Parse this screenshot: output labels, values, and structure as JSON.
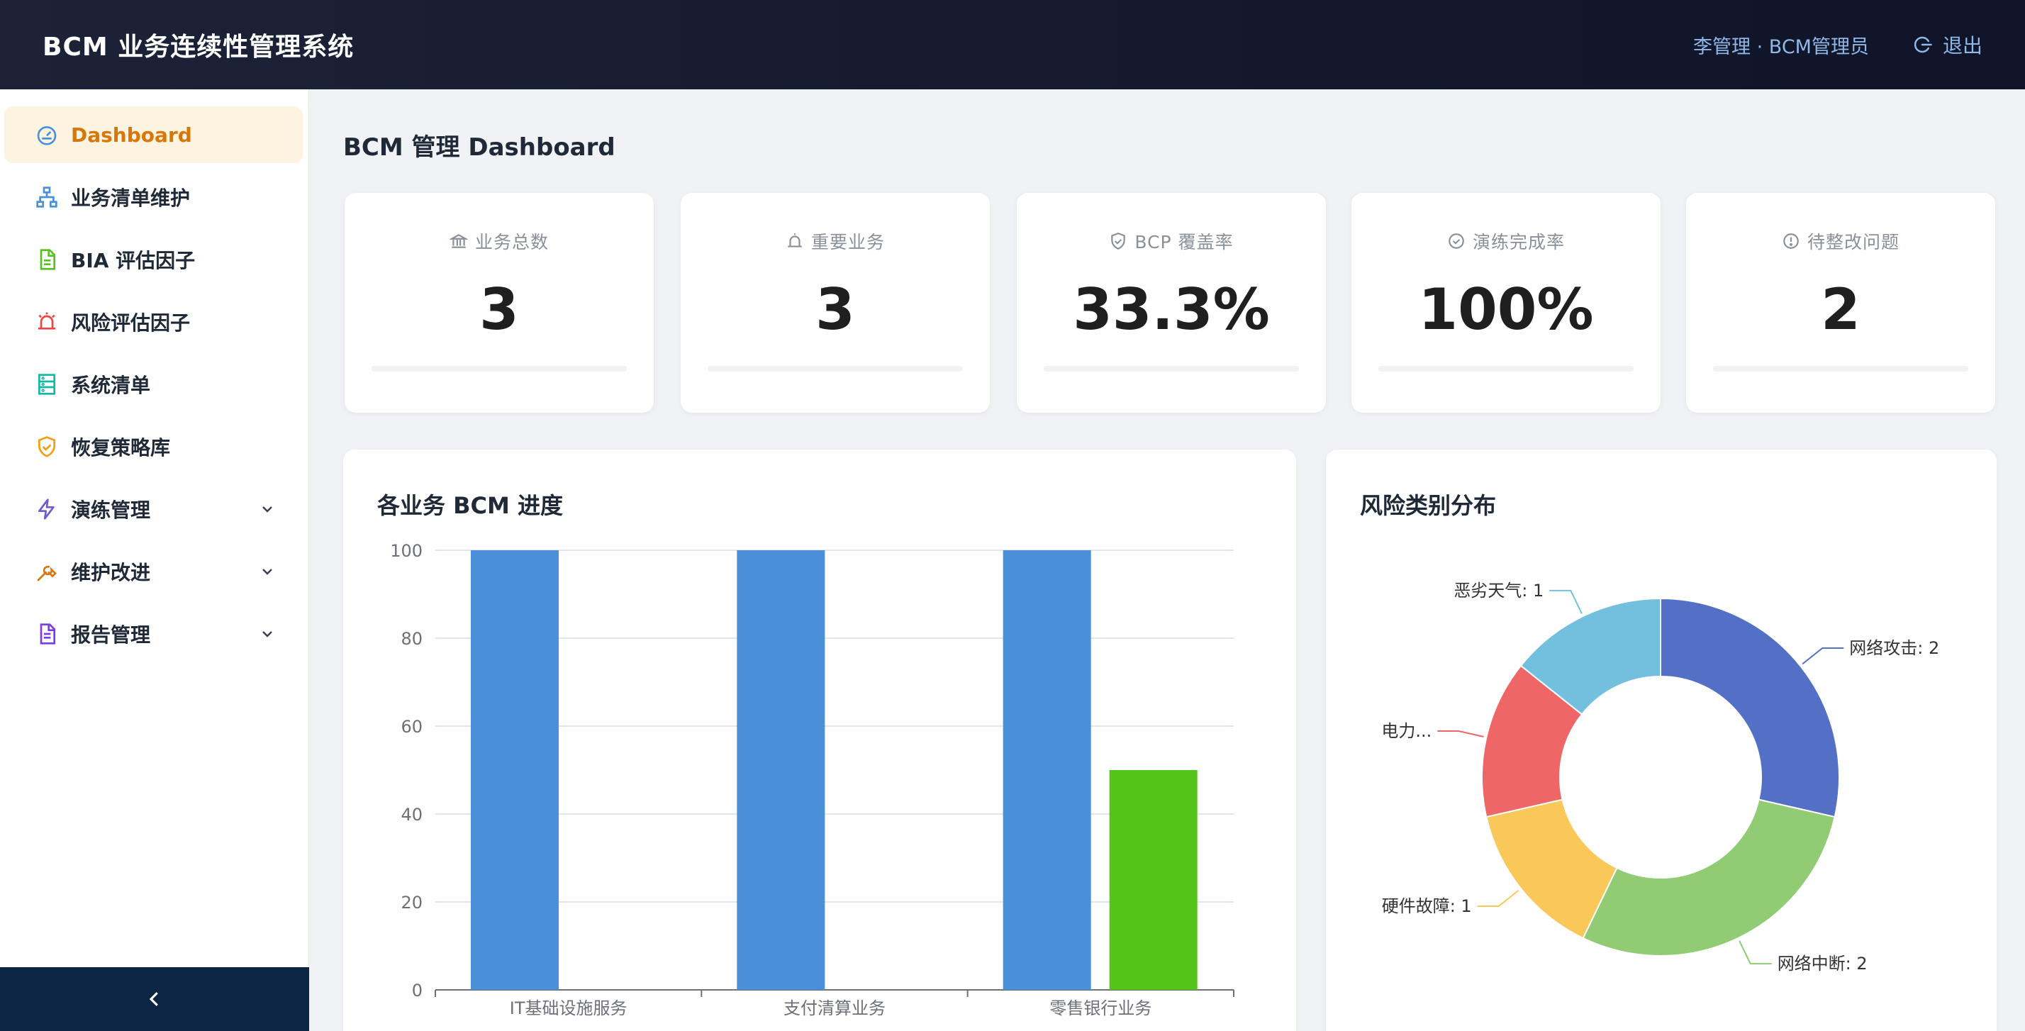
{
  "header": {
    "title": "BCM 业务连续性管理系统",
    "user": "李管理 · BCM管理员",
    "logout": "退出"
  },
  "sidebar": {
    "items": [
      {
        "label": "Dashboard",
        "icon": "dashboard-icon",
        "active": true
      },
      {
        "label": "业务清单维护",
        "icon": "sitemap-icon"
      },
      {
        "label": "BIA 评估因子",
        "icon": "document-icon"
      },
      {
        "label": "风险评估因子",
        "icon": "alarm-icon"
      },
      {
        "label": "系统清单",
        "icon": "server-icon"
      },
      {
        "label": "恢复策略库",
        "icon": "shield-check-icon"
      },
      {
        "label": "演练管理",
        "icon": "lightning-icon",
        "expandable": true
      },
      {
        "label": "维护改进",
        "icon": "wrench-icon",
        "expandable": true
      },
      {
        "label": "报告管理",
        "icon": "report-icon",
        "expandable": true
      }
    ],
    "collapse_icon": "chevron-left-icon"
  },
  "page": {
    "title": "BCM 管理 Dashboard"
  },
  "stats": [
    {
      "label": "业务总数",
      "value": "3",
      "icon": "bank-icon",
      "progress": 0
    },
    {
      "label": "重要业务",
      "value": "3",
      "icon": "alarm-icon",
      "progress": 0
    },
    {
      "label": "BCP 覆盖率",
      "value": "33.3%",
      "icon": "shield-check-icon",
      "progress": 0
    },
    {
      "label": "演练完成率",
      "value": "100%",
      "icon": "check-circle-icon",
      "progress": 0
    },
    {
      "label": "待整改问题",
      "value": "2",
      "icon": "info-circle-icon",
      "progress": 0
    }
  ],
  "bar_panel": {
    "title": "各业务 BCM 进度"
  },
  "pie_panel": {
    "title": "风险类别分布"
  },
  "colors": {
    "header_bg": "#151a30",
    "accent": "#d97706",
    "bar_blue": "#4a90d9",
    "bar_green": "#52c41a"
  },
  "chart_data": [
    {
      "type": "bar",
      "title": "各业务 BCM 进度",
      "categories": [
        "IT基础设施服务",
        "支付清算业务",
        "零售银行业务"
      ],
      "series": [
        {
          "values": [
            100,
            100,
            100
          ],
          "color": "#4a90d9"
        },
        {
          "values": [
            0,
            0,
            50
          ],
          "color": "#52c41a"
        }
      ],
      "ylim": [
        0,
        100
      ],
      "yticks": [
        0,
        20,
        40,
        60,
        80,
        100
      ],
      "grid": true
    },
    {
      "type": "pie",
      "title": "风险类别分布",
      "donut": true,
      "slices": [
        {
          "label": "网络攻击: 2",
          "value": 2,
          "color": "#5470c6"
        },
        {
          "label": "网络中断: 2",
          "value": 2,
          "color": "#91cc75"
        },
        {
          "label": "硬件故障: 1",
          "value": 1,
          "color": "#fac858"
        },
        {
          "label": "电力...",
          "value": 1,
          "color": "#ee6666"
        },
        {
          "label": "恶劣天气: 1",
          "value": 1,
          "color": "#73c0de"
        }
      ]
    }
  ]
}
